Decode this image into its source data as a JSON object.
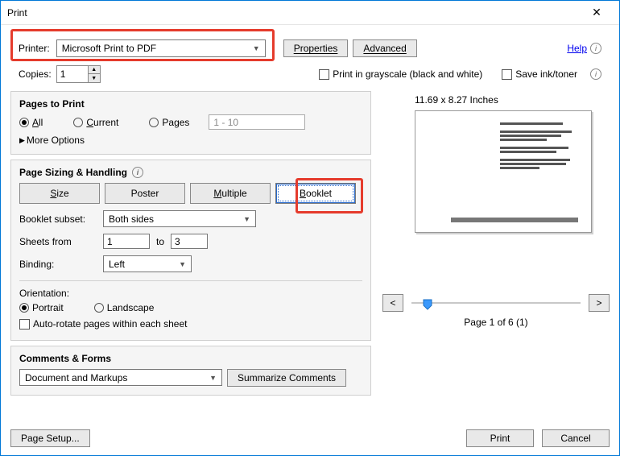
{
  "window": {
    "title": "Print"
  },
  "header": {
    "printer_label": "Printer:",
    "printer_value": "Microsoft Print to PDF",
    "properties_btn": "Properties",
    "advanced_btn": "Advanced",
    "help_link": "Help"
  },
  "copies": {
    "label": "Copies:",
    "value": "1",
    "grayscale_label": "Print in grayscale (black and white)",
    "saveink_label": "Save ink/toner"
  },
  "pages": {
    "title": "Pages to Print",
    "all": "All",
    "current": "Current",
    "pages": "Pages",
    "range": "1 - 10",
    "more": "More Options"
  },
  "sizing": {
    "title": "Page Sizing & Handling",
    "size": "Size",
    "poster": "Poster",
    "multiple": "Multiple",
    "booklet": "Booklet",
    "subset_label": "Booklet subset:",
    "subset_value": "Both sides",
    "sheets_from_label": "Sheets from",
    "sheets_from": "1",
    "to_label": "to",
    "sheets_to": "3",
    "binding_label": "Binding:",
    "binding_value": "Left"
  },
  "orientation": {
    "title": "Orientation:",
    "portrait": "Portrait",
    "landscape": "Landscape",
    "autorotate": "Auto-rotate pages within each sheet"
  },
  "comments": {
    "title": "Comments & Forms",
    "value": "Document and Markups",
    "summarize": "Summarize Comments"
  },
  "preview": {
    "dims": "11.69 x 8.27 Inches",
    "nav_prev": "<",
    "nav_next": ">",
    "indicator": "Page 1 of 6 (1)"
  },
  "footer": {
    "page_setup": "Page Setup...",
    "print": "Print",
    "cancel": "Cancel"
  }
}
